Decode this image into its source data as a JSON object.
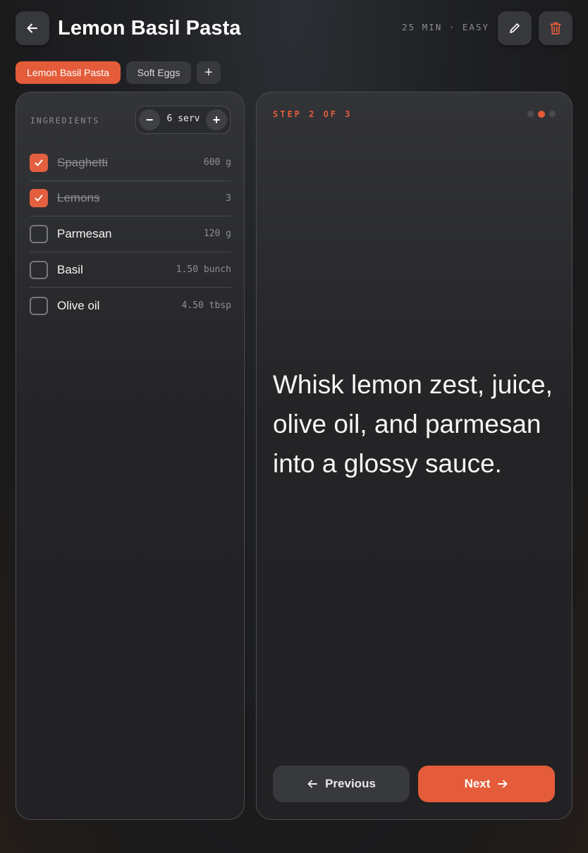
{
  "header": {
    "title": "Lemon Basil Pasta",
    "meta": "25 MIN · EASY",
    "back_icon": "arrow-left-icon",
    "edit_icon": "pencil-icon",
    "delete_icon": "trash-icon"
  },
  "tabs": [
    {
      "label": "Lemon Basil Pasta",
      "active": true
    },
    {
      "label": "Soft Eggs",
      "active": false
    }
  ],
  "add_tab_label": "+",
  "ingredients": {
    "label": "INGREDIENTS",
    "servings": "6 serv",
    "minus": "−",
    "plus": "+",
    "items": [
      {
        "name": "Spaghetti",
        "qty": "600 g",
        "checked": true
      },
      {
        "name": "Lemons",
        "qty": "3",
        "checked": true
      },
      {
        "name": "Parmesan",
        "qty": "120 g",
        "checked": false
      },
      {
        "name": "Basil",
        "qty": "1.50 bunch",
        "checked": false
      },
      {
        "name": "Olive oil",
        "qty": "4.50 tbsp",
        "checked": false
      }
    ]
  },
  "step": {
    "label": "STEP 2 OF 3",
    "current": 2,
    "total": 3,
    "text": "Whisk lemon zest, juice, olive oil, and parmesan into a glossy sauce."
  },
  "nav": {
    "previous": "Previous",
    "next": "Next"
  },
  "colors": {
    "accent": "#e45c3a",
    "panel": "#242426",
    "button": "#38393d"
  }
}
